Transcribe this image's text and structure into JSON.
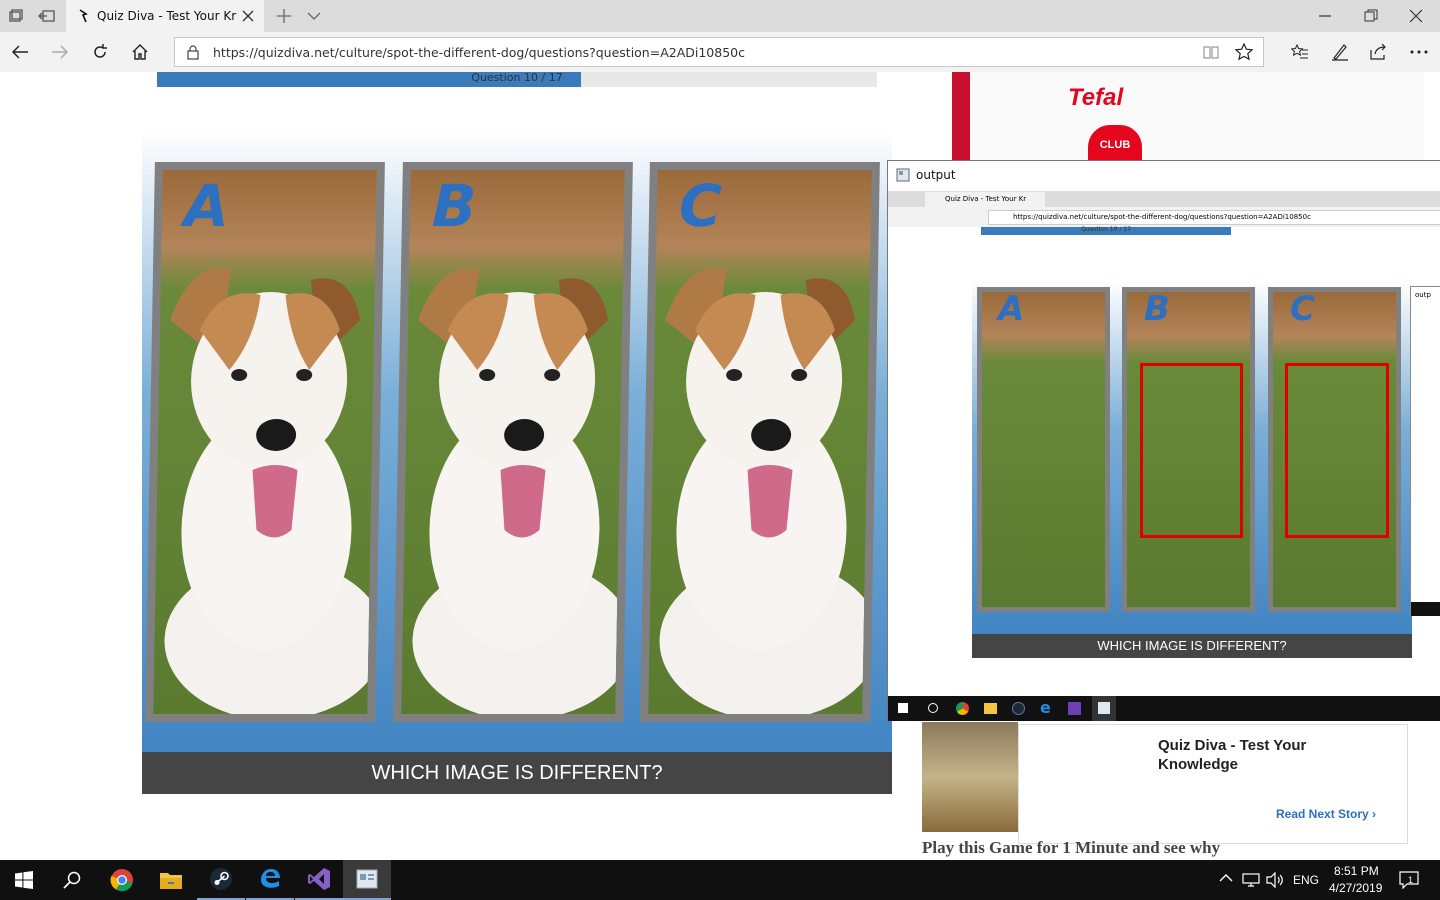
{
  "browser": {
    "tab_title": "Quiz Diva - Test Your Kr",
    "url": "https://quizdiva.net/culture/spot-the-different-dog/questions?question=A2ADi10850c"
  },
  "quiz": {
    "progress_label": "Question 10 / 17",
    "progress_fraction": 0.5882,
    "panels": [
      {
        "letter": "A"
      },
      {
        "letter": "B"
      },
      {
        "letter": "C"
      }
    ],
    "question": "WHICH IMAGE IS DIFFERENT?"
  },
  "ad": {
    "brand": "Tefal",
    "club_label": "CLUB",
    "card_title": "Quiz Diva - Test Your Knowledge",
    "card_link": "Read Next Story",
    "headline": "Play this Game for 1 Minute and see why"
  },
  "output_window": {
    "title": "output",
    "tab_title": "Quiz Diva - Test Your Kr",
    "url": "https://quizdiva.net/culture/spot-the-different-dog/questions?question=A2ADi10850c",
    "progress_label": "Question 10 / 17",
    "question": "WHICH IMAGE IS DIFFERENT?",
    "highlight_color": "#e00000",
    "nested_title": "outp"
  },
  "taskbar": {
    "apps": [
      "windows-start",
      "search",
      "chrome",
      "file-explorer",
      "steam",
      "edge",
      "visual-studio",
      "output-app"
    ],
    "language": "ENG",
    "time": "8:51 PM",
    "date": "4/27/2019",
    "notifications": "1"
  },
  "colors": {
    "accent_blue": "#3a7bbb",
    "question_bar": "#454545",
    "tefal_red": "#e3061c"
  }
}
